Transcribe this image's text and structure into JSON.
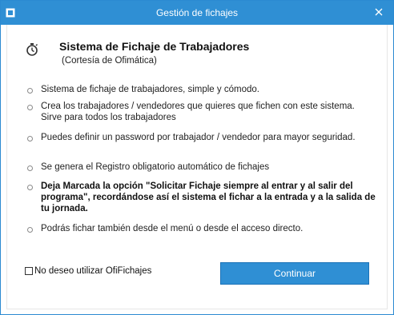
{
  "window": {
    "title": "Gestión de fichajes",
    "close_glyph": "✕"
  },
  "header": {
    "icon": "stopwatch-icon",
    "title": "Sistema de Fichaje de Trabajadores",
    "subtitle": "(Cortesía de Ofimática)"
  },
  "items": [
    {
      "text": "Sistema de fichaje de trabajadores, simple y cómodo.",
      "bold": false
    },
    {
      "text": "Crea los trabajadores / vendedores que quieres que fichen con este sistema. Sirve para todos los trabajadores",
      "bold": false
    },
    {
      "text": "Puedes definir un password por trabajador / vendedor para mayor seguridad.",
      "bold": false
    },
    {
      "text": "Se genera el Registro obligatorio automático de fichajes",
      "bold": false
    },
    {
      "text": "Deja Marcada la opción \"Solicitar Fichaje siempre al entrar y al salir del programa\", recordándose así el sistema el fichar a la entrada y a la salida de tu jornada.",
      "bold": true
    },
    {
      "text": "Podrás fichar también desde el menú o desde el acceso directo.",
      "bold": false
    }
  ],
  "footer": {
    "checkbox_label": "No deseo utilizar OfiFichajes",
    "checkbox_checked": false,
    "continue_label": "Continuar"
  },
  "colors": {
    "titlebar": "#2f8fd4",
    "button": "#2f8fd4"
  }
}
